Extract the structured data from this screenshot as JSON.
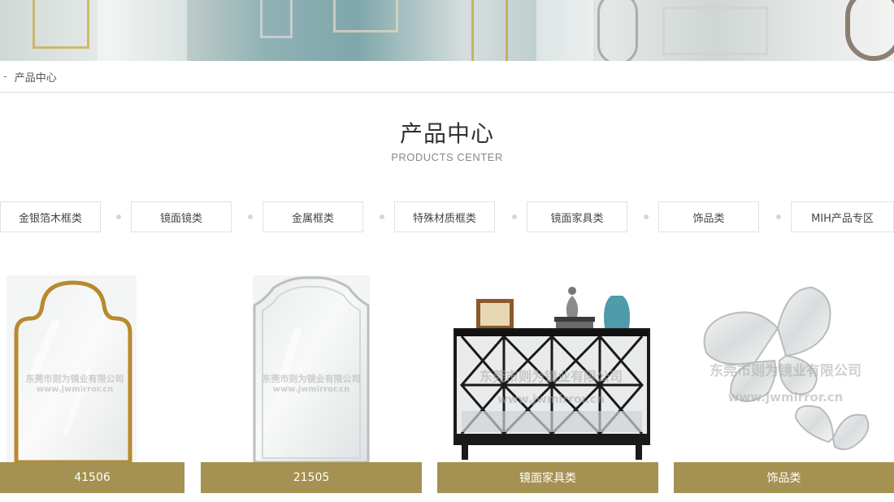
{
  "breadcrumb": {
    "separator": "-",
    "current": "产品中心"
  },
  "section": {
    "title": "产品中心",
    "subtitle": "PRODUCTS CENTER"
  },
  "categories": [
    {
      "label": "金银箔木框类"
    },
    {
      "label": "镜面镜类"
    },
    {
      "label": "金属框类"
    },
    {
      "label": "特殊材质框类"
    },
    {
      "label": "镜面家具类"
    },
    {
      "label": "饰品类"
    },
    {
      "label": "MIH产品专区"
    }
  ],
  "products": [
    {
      "caption": "41506",
      "watermark_cn": "东莞市则为镜业有限公司",
      "watermark_url": "www.jwmirror.cn"
    },
    {
      "caption": "21505",
      "watermark_cn": "东莞市则为镜业有限公司",
      "watermark_url": "www.jwmirror.cn"
    },
    {
      "caption": "镜面家具类",
      "watermark_cn": "东莞市则为镜业有限公司",
      "watermark_url": "www.jwmirror.cn"
    },
    {
      "caption": "饰品类",
      "watermark_cn": "东莞市则为镜业有限公司",
      "watermark_url": "www.jwmirror.cn"
    }
  ],
  "colors": {
    "caption_bg": "#a59151",
    "frame_gold": "#b8892f",
    "divider": "#d9d9d9"
  }
}
